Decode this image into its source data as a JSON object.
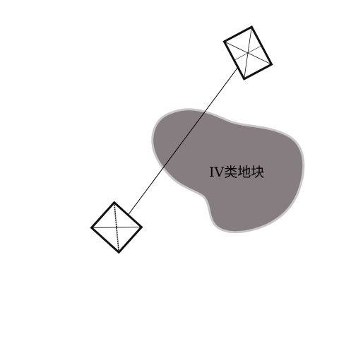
{
  "diagram": {
    "plot": {
      "label": "IV类地块",
      "fill_color": "#867d80",
      "edge_color": "#c9c6c7"
    },
    "connector": {
      "stroke_color": "#000000"
    },
    "symbols": {
      "stroke_color": "#111111",
      "icon": "boxed-cross-marker"
    }
  }
}
